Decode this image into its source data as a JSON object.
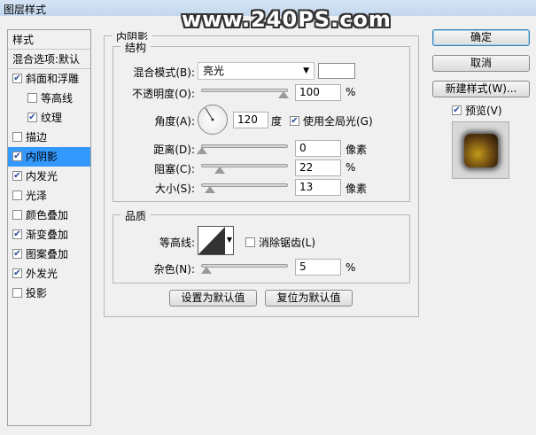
{
  "window": {
    "title": "图层样式",
    "watermark": "www.240PS.com"
  },
  "styles": {
    "header": "样式",
    "blending": "混合选项:默认",
    "items": [
      {
        "label": "斜面和浮雕",
        "checked": true,
        "indent": false
      },
      {
        "label": "等高线",
        "checked": false,
        "indent": true
      },
      {
        "label": "纹理",
        "checked": true,
        "indent": true
      },
      {
        "label": "描边",
        "checked": false,
        "indent": false
      },
      {
        "label": "内阴影",
        "checked": true,
        "indent": false,
        "selected": true
      },
      {
        "label": "内发光",
        "checked": true,
        "indent": false
      },
      {
        "label": "光泽",
        "checked": false,
        "indent": false
      },
      {
        "label": "颜色叠加",
        "checked": false,
        "indent": false
      },
      {
        "label": "渐变叠加",
        "checked": true,
        "indent": false
      },
      {
        "label": "图案叠加",
        "checked": true,
        "indent": false
      },
      {
        "label": "外发光",
        "checked": true,
        "indent": false
      },
      {
        "label": "投影",
        "checked": false,
        "indent": false
      }
    ]
  },
  "panel": {
    "title": "内阴影",
    "structure": {
      "title": "结构",
      "blend_mode_label": "混合模式(B):",
      "blend_mode": "亮光",
      "color": "#ffffff",
      "opacity_label": "不透明度(O):",
      "opacity": "100",
      "opacity_unit": "%",
      "opacity_fraction": 1.0,
      "angle_label": "角度(A):",
      "angle": "120",
      "angle_unit": "度",
      "global_light_label": "使用全局光(G)",
      "global_light": true,
      "distance_label": "距离(D):",
      "distance": "0",
      "distance_unit": "像素",
      "distance_fraction": 0.0,
      "choke_label": "阻塞(C):",
      "choke": "22",
      "choke_unit": "%",
      "choke_fraction": 0.22,
      "size_label": "大小(S):",
      "size": "13",
      "size_unit": "像素",
      "size_fraction": 0.1
    },
    "quality": {
      "title": "品质",
      "contour_label": "等高线:",
      "anti_alias_label": "消除锯齿(L)",
      "anti_alias": false,
      "noise_label": "杂色(N):",
      "noise": "5",
      "noise_unit": "%",
      "noise_fraction": 0.05
    },
    "make_default": "设置为默认值",
    "reset_default": "复位为默认值"
  },
  "actions": {
    "ok": "确定",
    "cancel": "取消",
    "new_style": "新建样式(W)...",
    "preview_label": "预览(V)",
    "preview": true
  }
}
